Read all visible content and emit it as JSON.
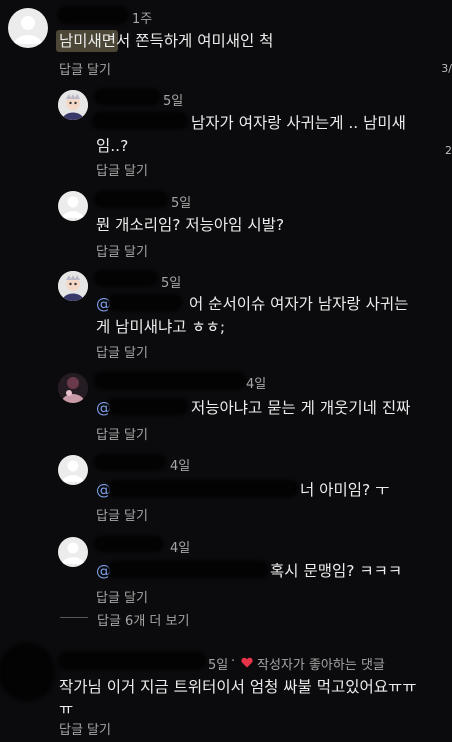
{
  "top_comment": {
    "time": "1주",
    "text": "남미새면서 쫀득하게 여미새인 척",
    "reply_label": "답글 달기"
  },
  "replies": [
    {
      "time": "5일",
      "mention": "",
      "text": "남자가 여자랑 사귀는게 .. 남미새",
      "text2": "임..?",
      "reply_label": "답글 달기"
    },
    {
      "time": "5일",
      "mention": "",
      "text": "뭔 개소리임? 저능아임 시발?",
      "text2": "",
      "reply_label": "답글 달기"
    },
    {
      "time": "5일",
      "mention": "@",
      "text": "어 순서이슈 여자가 남자랑 사귀는",
      "text2": "게 남미새냐고 ㅎㅎ;",
      "reply_label": "답글 달기"
    },
    {
      "time": "4일",
      "mention": "@",
      "text": "저능아냐고 묻는 게 개웃기네 진짜",
      "text2": "",
      "reply_label": "답글 달기"
    },
    {
      "time": "4일",
      "mention": "@",
      "text": "너 아미임? ㅜ",
      "text2": "",
      "reply_label": "답글 달기"
    },
    {
      "time": "4일",
      "mention": "@",
      "text": "혹시 문맹임? ㅋㅋㅋ",
      "text2": "",
      "reply_label": "답글 달기"
    }
  ],
  "more_replies_label": "답글 6개 더 보기",
  "second_comment": {
    "time": "5일",
    "separator": "·",
    "liked_text": "작성자가 좋아하는 댓글",
    "text": "작가님 이거 지금 트위터이서 엄청 싸불 먹고있어요ㅠㅠ",
    "text2": "ㅠ",
    "reply_label": "답글 달기"
  },
  "edge_counts": [
    "3/",
    "2"
  ],
  "colors": {
    "background": "#0b0b0d",
    "mention": "#7ea2e8",
    "heart": "#e8344a",
    "highlight": "#f3e3a0"
  }
}
